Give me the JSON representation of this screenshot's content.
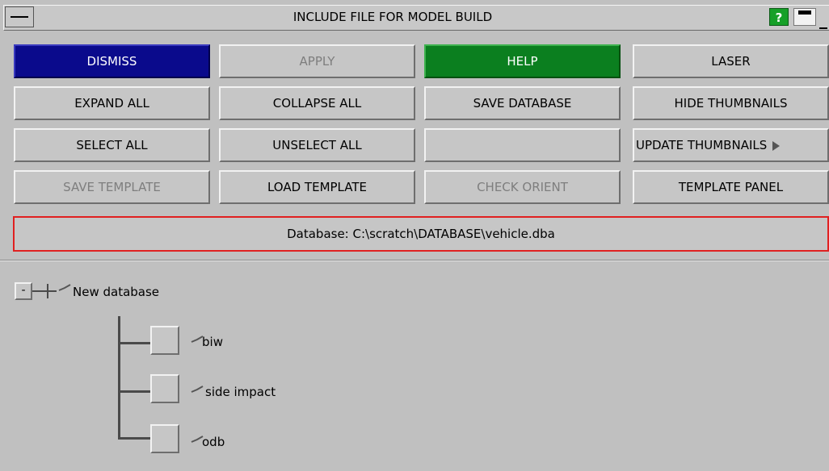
{
  "window": {
    "title": "INCLUDE FILE FOR MODEL BUILD",
    "help_label": "?"
  },
  "buttons": {
    "dismiss": "DISMISS",
    "apply": "APPLY",
    "help": "HELP",
    "laser": "LASER",
    "expand_all": "EXPAND ALL",
    "collapse_all": "COLLAPSE ALL",
    "save_database": "SAVE DATABASE",
    "hide_thumbnails": "HIDE THUMBNAILS",
    "select_all": "SELECT ALL",
    "unselect_all": "UNSELECT ALL",
    "update_thumbnails": "UPDATE THUMBNAILS",
    "save_template": "SAVE TEMPLATE",
    "load_template": "LOAD TEMPLATE",
    "check_orient": "CHECK ORIENT",
    "template_panel": "TEMPLATE PANEL"
  },
  "database": {
    "label": "Database: C:\\scratch\\DATABASE\\vehicle.dba"
  },
  "tree": {
    "root": {
      "toggle": "-",
      "label": "New database"
    },
    "children": [
      {
        "label": "biw"
      },
      {
        "label": "side impact"
      },
      {
        "label": "odb"
      }
    ]
  },
  "colors": {
    "dismiss_bg": "#0a0a8c",
    "help_bg": "#0b7f1f",
    "help_icon_bg": "#16a028",
    "db_border": "#e02020",
    "panel_bg": "#c0c0c0"
  },
  "icons": {
    "system_menu": "window-menu-icon",
    "help": "question-mark-icon",
    "minimize": "minimize-icon",
    "update_arrow": "play-arrow-icon",
    "tree_tick": "checkmark-icon"
  }
}
